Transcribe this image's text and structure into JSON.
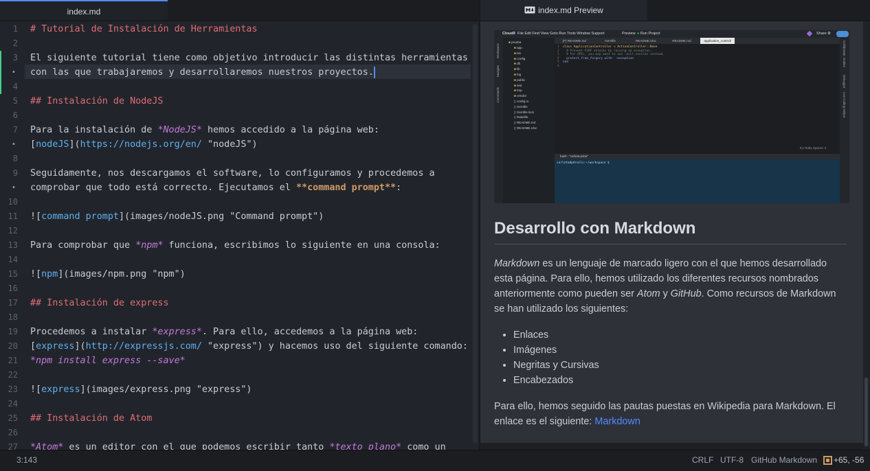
{
  "tabs": {
    "editor": "index.md",
    "preview": "index.md Preview",
    "preview_icon": "markdown-icon"
  },
  "editor": {
    "line_numbers": [
      "1",
      "2",
      "3",
      "4",
      "5",
      "6",
      "7",
      "8",
      "9",
      "10",
      "11",
      "12",
      "13",
      "14",
      "15",
      "16",
      "17",
      "18",
      "19",
      "20",
      "21",
      "22",
      "23",
      "24",
      "25",
      "26",
      "27"
    ],
    "lines": [
      [
        {
          "t": "# Tutorial de Instalación de Herramientas",
          "c": "hdr"
        }
      ],
      [],
      [
        {
          "t": "El siguiente tutorial tiene como objetivo introducir las distintas herramientas",
          "c": ""
        }
      ],
      [
        {
          "t": "con las que trabajaremos y desarrollaremos nuestros proyectos.",
          "c": ""
        }
      ],
      [],
      [
        {
          "t": "## Instalación de NodeJS",
          "c": "hdr"
        }
      ],
      [],
      [
        {
          "t": "Para la instalación de ",
          "c": ""
        },
        {
          "t": "*NodeJS*",
          "c": "em"
        },
        {
          "t": " hemos accedido a la página web:",
          "c": ""
        }
      ],
      [
        {
          "t": "[",
          "c": ""
        },
        {
          "t": "nodeJS",
          "c": "link"
        },
        {
          "t": "](",
          "c": ""
        },
        {
          "t": "https://nodejs.org/en/",
          "c": "link"
        },
        {
          "t": " \"nodeJS\")",
          "c": ""
        }
      ],
      [],
      [
        {
          "t": "Seguidamente, nos descargamos el software, lo configuramos y procedemos a",
          "c": ""
        }
      ],
      [
        {
          "t": "comprobar que todo está correcto. Ejecutamos el ",
          "c": ""
        },
        {
          "t": "**command prompt**",
          "c": "bold"
        },
        {
          "t": ":",
          "c": ""
        }
      ],
      [],
      [
        {
          "t": "![",
          "c": ""
        },
        {
          "t": "command prompt",
          "c": "link"
        },
        {
          "t": "](images/nodeJS.png \"Command prompt\")",
          "c": ""
        }
      ],
      [],
      [
        {
          "t": "Para comprobar que ",
          "c": ""
        },
        {
          "t": "*npm*",
          "c": "em"
        },
        {
          "t": " funciona, escribimos lo siguiente en una consola:",
          "c": ""
        }
      ],
      [],
      [
        {
          "t": "![",
          "c": ""
        },
        {
          "t": "npm",
          "c": "link"
        },
        {
          "t": "](images/npm.png \"npm\")",
          "c": ""
        }
      ],
      [],
      [
        {
          "t": "## Instalación de express",
          "c": "hdr"
        }
      ],
      [],
      [
        {
          "t": "Procedemos a instalar ",
          "c": ""
        },
        {
          "t": "*express*",
          "c": "em"
        },
        {
          "t": ". Para ello, accedemos a la página web:",
          "c": ""
        }
      ],
      [
        {
          "t": "[",
          "c": ""
        },
        {
          "t": "express",
          "c": "link"
        },
        {
          "t": "](",
          "c": ""
        },
        {
          "t": "http://expressjs.com/",
          "c": "link"
        },
        {
          "t": " \"express\") y hacemos uso del siguiente comando:",
          "c": ""
        }
      ],
      [
        {
          "t": "*npm install express --save*",
          "c": "em"
        }
      ],
      [],
      [
        {
          "t": "![",
          "c": ""
        },
        {
          "t": "express",
          "c": "link"
        },
        {
          "t": "](images/express.png \"express\")",
          "c": ""
        }
      ],
      [],
      [
        {
          "t": "## Instalación de Atom",
          "c": "hdr"
        }
      ],
      [],
      [
        {
          "t": "*Atom*",
          "c": "em"
        },
        {
          "t": " es un editor con el que podemos escribir tanto ",
          "c": ""
        },
        {
          "t": "*texto plano*",
          "c": "em"
        },
        {
          "t": " como un",
          "c": ""
        }
      ]
    ]
  },
  "preview": {
    "heading": "Desarrollo con Markdown",
    "paragraph1": [
      {
        "t": "Markdown",
        "c": "i"
      },
      {
        "t": " es un lenguaje de marcado ligero con el que hemos desarrollado esta página. Para ello, hemos utilizado los diferentes recursos nombrados anteriormente como pueden ser ",
        "c": ""
      },
      {
        "t": "Atom",
        "c": "i"
      },
      {
        "t": " y ",
        "c": ""
      },
      {
        "t": "GitHub",
        "c": "i"
      },
      {
        "t": ". Como recursos de Markdown se han utilizado los siguientes:",
        "c": ""
      }
    ],
    "list": [
      "Enlaces",
      "Imágenes",
      "Negritas y Cursivas",
      "Encabezados"
    ],
    "paragraph2": "Para ello, hemos seguido las pautas puestas en Wikipedia para Markdown. El enlace es el siguiente: ",
    "link": "Markdown",
    "screenshot": {
      "app": "Cloud9",
      "menu": [
        "File",
        "Edit",
        "Find",
        "View",
        "Goto",
        "Run",
        "Tools",
        "Window",
        "Support"
      ],
      "preview_btn": "Preview",
      "run_btn": "Run Project",
      "share_btn": "Share",
      "tabs": [
        "[F] README.md",
        "Gemfile",
        "README.rdoc",
        "README.md",
        "application_controll"
      ],
      "tree_root": "prueba",
      "tree": [
        "app",
        "bin",
        "config",
        "db",
        "lib",
        "log",
        "public",
        "test",
        "tmp",
        "vendor",
        "config.ru",
        "Gemfile",
        "Gemfile.lock",
        "Rakefile",
        "README.md",
        "README.rdoc"
      ],
      "code": [
        "class ApplicationController < ActionController::Base",
        "  # Prevent CSRF attacks by raising an exception.",
        "  # For APIs, you may want to use :null_session instead.",
        "  protect_from_forgery with: :exception",
        "end",
        ""
      ],
      "side_labels": [
        "Workspace",
        "Navigate",
        "Commands"
      ],
      "right_labels": [
        "Collaborate",
        "Outline",
        "Debugger",
        "Live Coding Helper"
      ],
      "statusline": "5:1   Ruby   Spaces: 2",
      "terminal_tab": "bash - \"carlota-p4rai\"",
      "terminal_prompt": "carlotadp4rails:~/workspace $"
    }
  },
  "status": {
    "position": "3:143",
    "line_ending": "CRLF",
    "encoding": "UTF-8",
    "grammar": "GitHub Markdown",
    "git_diff": "+65, -56"
  },
  "colors": {
    "accent": "#528bff",
    "git_added": "#43d08a",
    "header": "#e06c75",
    "link": "#61afef",
    "italic": "#c678dd",
    "bold": "#d19a66"
  }
}
